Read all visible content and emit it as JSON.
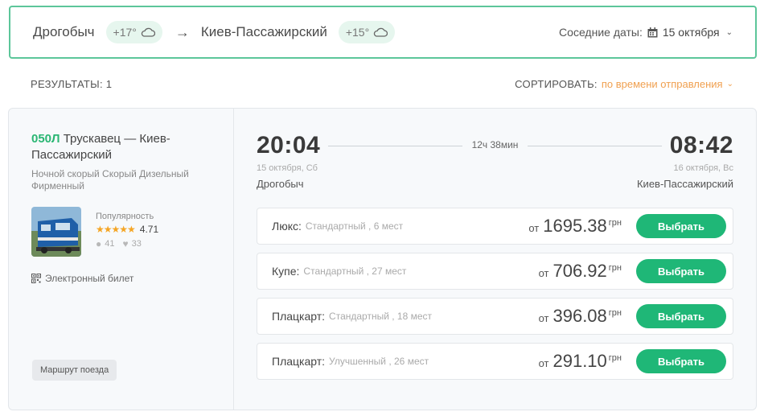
{
  "route": {
    "from_city": "Дрогобыч",
    "from_temp": "+17°",
    "arrow": "→",
    "to_city": "Киев-Пассажирский",
    "to_temp": "+15°",
    "near_dates_label": "Соседние даты:",
    "near_dates_value": "15 октября"
  },
  "results": {
    "label": "РЕЗУЛЬТАТЫ: 1",
    "sort_label": "СОРТИРОВАТЬ:",
    "sort_value": "по времени отправления"
  },
  "train": {
    "number": "050Л",
    "route_name": "Трускавец — Киев-Пассажирский",
    "type": "Ночной скорый Скорый Дизельный Фирменный",
    "popularity_label": "Популярность",
    "stars": "★★★★★",
    "rating": "4.71",
    "comments": "41",
    "likes": "33",
    "eticket": "Электронный билет",
    "route_button": "Маршрут поезда"
  },
  "trip": {
    "depart_time": "20:04",
    "arrive_time": "08:42",
    "duration": "12ч 38мин",
    "depart_date": "15 октября, Сб",
    "arrive_date": "16 октября, Вс",
    "depart_station": "Дрогобыч",
    "arrive_station": "Киев-Пассажирский"
  },
  "offers": [
    {
      "class": "Люкс:",
      "detail": "Стандартный , 6 мест",
      "from": "от",
      "price": "1695.38",
      "currency": "грн",
      "button": "Выбрать"
    },
    {
      "class": "Купе:",
      "detail": "Стандартный , 27 мест",
      "from": "от",
      "price": "706.92",
      "currency": "грн",
      "button": "Выбрать"
    },
    {
      "class": "Плацкарт:",
      "detail": "Стандартный , 18 мест",
      "from": "от",
      "price": "396.08",
      "currency": "грн",
      "button": "Выбрать"
    },
    {
      "class": "Плацкарт:",
      "detail": "Улучшенный , 26 мест",
      "from": "от",
      "price": "291.10",
      "currency": "грн",
      "button": "Выбрать"
    }
  ],
  "colors": {
    "accent": "#1fb777",
    "border_green": "#5cc69a",
    "sort_orange": "#f0a050",
    "star": "#f5a524"
  },
  "icons": [
    "cloud-icon",
    "calendar-icon",
    "chevron-down-icon",
    "comment-icon",
    "heart-icon",
    "qr-code-icon"
  ]
}
